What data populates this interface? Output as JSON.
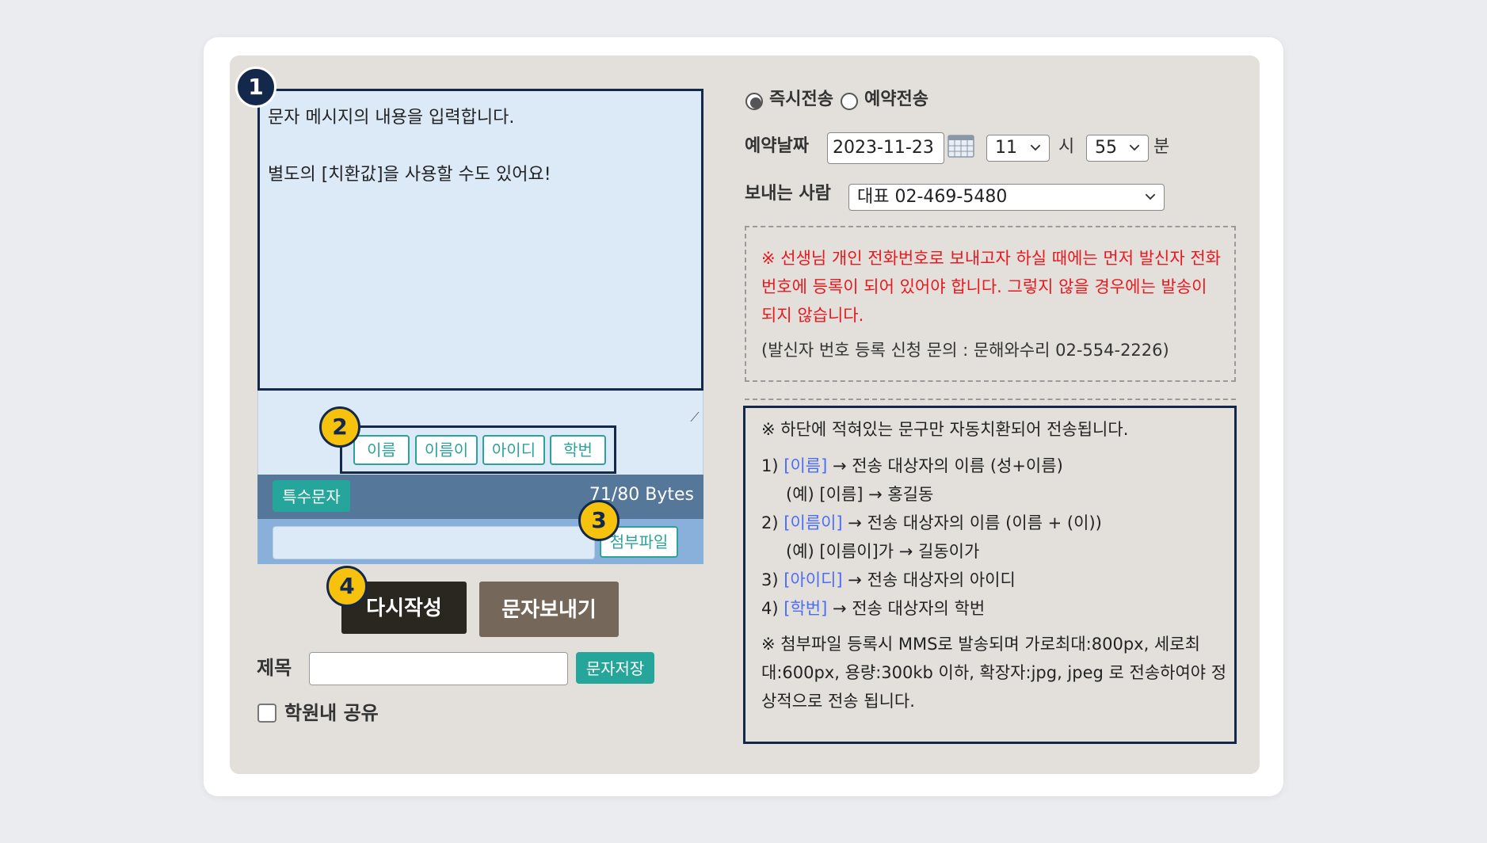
{
  "editor": {
    "message_text": "문자 메시지의 내용을 입력합니다.\n\n별도의 [치환값]을 사용할 수도 있어요!",
    "resize_glyph": "⟋"
  },
  "tokens": [
    "이름",
    "이름이",
    "아이디",
    "학번"
  ],
  "special_chars_label": "특수문자",
  "byte_counter": "71/80 Bytes",
  "attach_label": "첨부파일",
  "buttons": {
    "reset_label": "다시작성",
    "send_label": "문자보내기",
    "save_label": "문자저장"
  },
  "title_field": {
    "label": "제목",
    "value": ""
  },
  "share": {
    "label": "학원내 공유",
    "checked": false
  },
  "send_mode": {
    "options": [
      "즉시전송",
      "예약전송"
    ],
    "selected": "즉시전송"
  },
  "reservation": {
    "label": "예약날짜",
    "date": "2023-11-23",
    "hour": "11",
    "hour_unit": "시",
    "minute": "55",
    "minute_unit": "분"
  },
  "sender": {
    "label": "보내는 사람",
    "selected": "대표 02-469-5480"
  },
  "notice": {
    "warning": "※ 선생님 개인 전화번호로 보내고자 하실 때에는 먼저 발신자 전화번호에 등록이 되어 있어야 합니다. 그렇지 않을 경우에는 발송이 되지 않습니다.",
    "contact": "(발신자 번호 등록 신청 문의 : 문해와수리 02-554-2226)"
  },
  "guide": {
    "heading": "※ 하단에 적혀있는 문구만 자동치환되어 전송됩니다.",
    "items": [
      {
        "num": "1)",
        "token": "[이름]",
        "desc": "→ 전송 대상자의 이름 (성+이름)",
        "example": "(예) [이름] → 홍길동"
      },
      {
        "num": "2)",
        "token": "[이름이]",
        "desc": "→ 전송 대상자의 이름 (이름 + (이))",
        "example": "(예) [이름이]가 → 길동이가"
      },
      {
        "num": "3)",
        "token": "[아이디]",
        "desc": "→ 전송 대상자의 아이디",
        "example": ""
      },
      {
        "num": "4)",
        "token": "[학번]",
        "desc": "→ 전송 대상자의 학번",
        "example": ""
      }
    ],
    "attachment_note": "※ 첨부파일 등록시 MMS로 발송되며 가로최대:800px, 세로최대:600px, 용량:300kb 이하, 확장자:jpg, jpeg 로 전송하여야 정상적으로 전송 됩니다."
  },
  "callouts": [
    "1",
    "2",
    "3",
    "4"
  ],
  "colors": {
    "accent_teal": "#26a69a",
    "navy": "#14284b",
    "callout_yellow": "#f6c20e",
    "warning_red": "#e8181f",
    "token_blue": "#4a6cf7"
  }
}
